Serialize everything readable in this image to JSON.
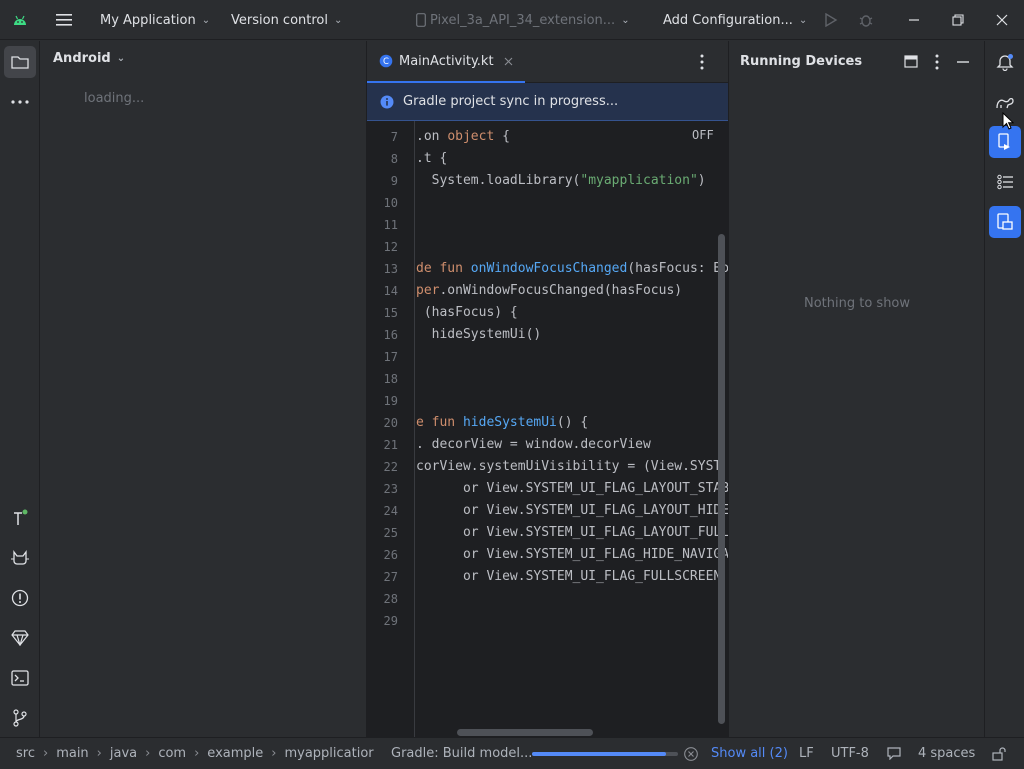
{
  "titlebar": {
    "project_name": "My Application",
    "vcs": "Version control",
    "device": "Pixel_3a_API_34_extension...",
    "run_config": "Add Configuration..."
  },
  "project_panel": {
    "view_selector": "Android",
    "loading_text": "loading..."
  },
  "editor": {
    "tab_label": "MainActivity.kt",
    "sync_message": "Gradle project sync in progress...",
    "off_label": "OFF",
    "line_numbers": [
      "7",
      "8",
      "9",
      "10",
      "11",
      "12",
      "13",
      "14",
      "15",
      "16",
      "17",
      "18",
      "19",
      "20",
      "21",
      "22",
      "23",
      "24",
      "25",
      "26",
      "27",
      "28",
      "29"
    ],
    "code_lines": [
      [
        {
          "t": ".on ",
          "c": ""
        },
        {
          "t": "object",
          "c": "kw"
        },
        {
          "t": " {",
          "c": ""
        }
      ],
      [
        {
          "t": ".t {",
          "c": ""
        }
      ],
      [
        {
          "t": "  System.loadLibrary(",
          "c": ""
        },
        {
          "t": "\"myapplication\"",
          "c": "str"
        },
        {
          "t": ")",
          "c": ""
        }
      ],
      [],
      [],
      [],
      [
        {
          "t": "de ",
          "c": "kw"
        },
        {
          "t": "fun ",
          "c": "kw"
        },
        {
          "t": "onWindowFocusChanged",
          "c": "fn"
        },
        {
          "t": "(hasFocus: Bo",
          "c": ""
        }
      ],
      [
        {
          "t": "per",
          "c": "kw"
        },
        {
          "t": ".onWindowFocusChanged(hasFocus)",
          "c": ""
        }
      ],
      [
        {
          "t": " (hasFocus) {",
          "c": ""
        }
      ],
      [
        {
          "t": "  hideSystemUi()",
          "c": ""
        }
      ],
      [],
      [],
      [],
      [
        {
          "t": "e ",
          "c": "kw"
        },
        {
          "t": "fun ",
          "c": "kw"
        },
        {
          "t": "hideSystemUi",
          "c": "fn"
        },
        {
          "t": "() {",
          "c": ""
        }
      ],
      [
        {
          "t": ". decorView = window.decorView",
          "c": ""
        }
      ],
      [
        {
          "t": "corView.systemUiVisibility = (View.SYST",
          "c": ""
        }
      ],
      [
        {
          "t": "      or View.SYSTEM_UI_FLAG_LAYOUT_STAB",
          "c": ""
        }
      ],
      [
        {
          "t": "      or View.SYSTEM_UI_FLAG_LAYOUT_HIDE",
          "c": ""
        }
      ],
      [
        {
          "t": "      or View.SYSTEM_UI_FLAG_LAYOUT_FULL",
          "c": ""
        }
      ],
      [
        {
          "t": "      or View.SYSTEM_UI_FLAG_HIDE_NAVIGA",
          "c": ""
        }
      ],
      [
        {
          "t": "      or View.SYSTEM_UI_FLAG_FULLSCREEN",
          "c": ""
        }
      ],
      [],
      []
    ]
  },
  "running_devices": {
    "title": "Running Devices",
    "empty_text": "Nothing to show"
  },
  "statusbar": {
    "breadcrumbs": [
      "src",
      "main",
      "java",
      "com",
      "example",
      "myapplicatior"
    ],
    "task": "Gradle: Build model...",
    "task_progress": 0.92,
    "show_all": "Show all (2)",
    "line_sep": "LF",
    "encoding": "UTF-8",
    "indent": "4 spaces"
  },
  "colors": {
    "accent": "#3574f0",
    "background": "#2b2d30",
    "editor_bg": "#1e1f22",
    "banner_bg": "#25324d"
  },
  "icons": {
    "titlebar": [
      "android-icon",
      "hamburger-menu-icon",
      "run-icon",
      "debug-icon",
      "minimize-icon",
      "restore-icon",
      "close-icon"
    ],
    "left_strip": [
      "folder-icon",
      "more-icon",
      "build-icon",
      "logcat-icon",
      "problems-icon",
      "gem-icon",
      "terminal-icon",
      "git-branch-icon"
    ],
    "right_strip": [
      "notifications-icon",
      "gradle-icon",
      "running-devices-icon",
      "structure-icon",
      "device-manager-icon"
    ]
  }
}
